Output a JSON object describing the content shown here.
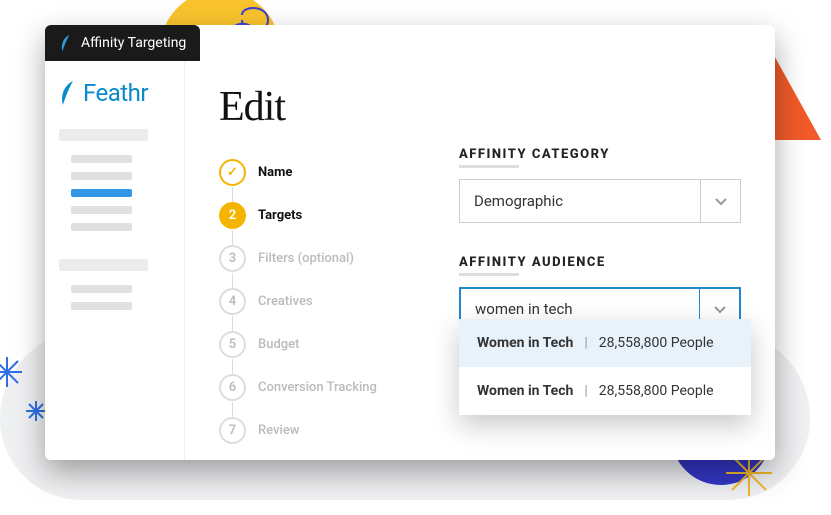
{
  "window": {
    "title": "Affinity Targeting"
  },
  "brand": {
    "name": "Feathr"
  },
  "page": {
    "title": "Edit"
  },
  "steps": [
    {
      "num": "✓",
      "label": "Name",
      "state": "done"
    },
    {
      "num": "2",
      "label": "Targets",
      "state": "active"
    },
    {
      "num": "3",
      "label": "Filters (optional)",
      "state": ""
    },
    {
      "num": "4",
      "label": "Creatives",
      "state": ""
    },
    {
      "num": "5",
      "label": "Budget",
      "state": ""
    },
    {
      "num": "6",
      "label": "Conversion Tracking",
      "state": ""
    },
    {
      "num": "7",
      "label": "Review",
      "state": ""
    }
  ],
  "fields": {
    "category": {
      "label": "AFFINITY CATEGORY",
      "value": "Demographic"
    },
    "audience": {
      "label": "AFFINITY AUDIENCE",
      "value": "women in tech"
    }
  },
  "options": [
    {
      "name": "Women in Tech",
      "count": "28,558,800 People"
    },
    {
      "name": "Women in Tech",
      "count": "28,558,800 People"
    }
  ]
}
